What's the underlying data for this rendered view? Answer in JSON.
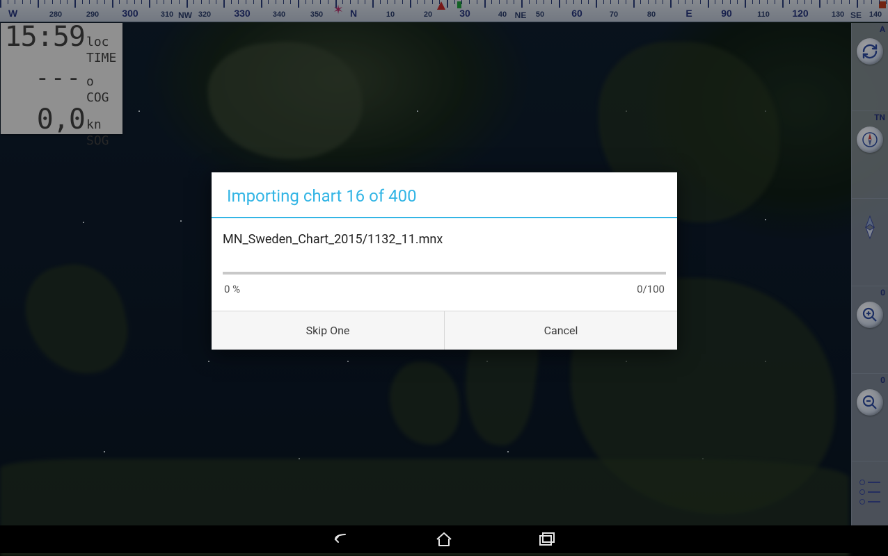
{
  "compass": {
    "cardinals": {
      "W": "W",
      "NW": "NW",
      "N": "N",
      "NE": "NE",
      "E": "E",
      "SE": "SE"
    },
    "major_labels": [
      "300",
      "330",
      "30",
      "60",
      "90",
      "120"
    ],
    "minor_labels": [
      "280",
      "290",
      "310",
      "320",
      "340",
      "350",
      "10",
      "20",
      "40",
      "50",
      "70",
      "80",
      "100",
      "110",
      "130",
      "140"
    ]
  },
  "info_panel": {
    "time": {
      "value": "15:59",
      "unit": "loc",
      "label": "TIME"
    },
    "cog": {
      "value": "---",
      "unit": "o",
      "label": "COG"
    },
    "sog": {
      "value": "0,0",
      "unit": "kn",
      "label": "SOG"
    }
  },
  "right_toolbar": {
    "slots": [
      {
        "badge": "A",
        "icon": "sync"
      },
      {
        "badge": "TN",
        "icon": "compass"
      },
      {
        "badge": "",
        "icon": "north-arrow"
      },
      {
        "badge": "0",
        "icon": "zoom-in"
      },
      {
        "badge": "0",
        "icon": "zoom-out"
      },
      {
        "badge": "",
        "icon": "layers-list"
      }
    ]
  },
  "dialog": {
    "title": "Importing chart 16 of 400",
    "filename": "MN_Sweden_Chart_2015/1132_11.mnx",
    "percent_label": "0 %",
    "progress_pct": 0,
    "count_label": "0/100",
    "skip_label": "Skip One",
    "cancel_label": "Cancel"
  }
}
